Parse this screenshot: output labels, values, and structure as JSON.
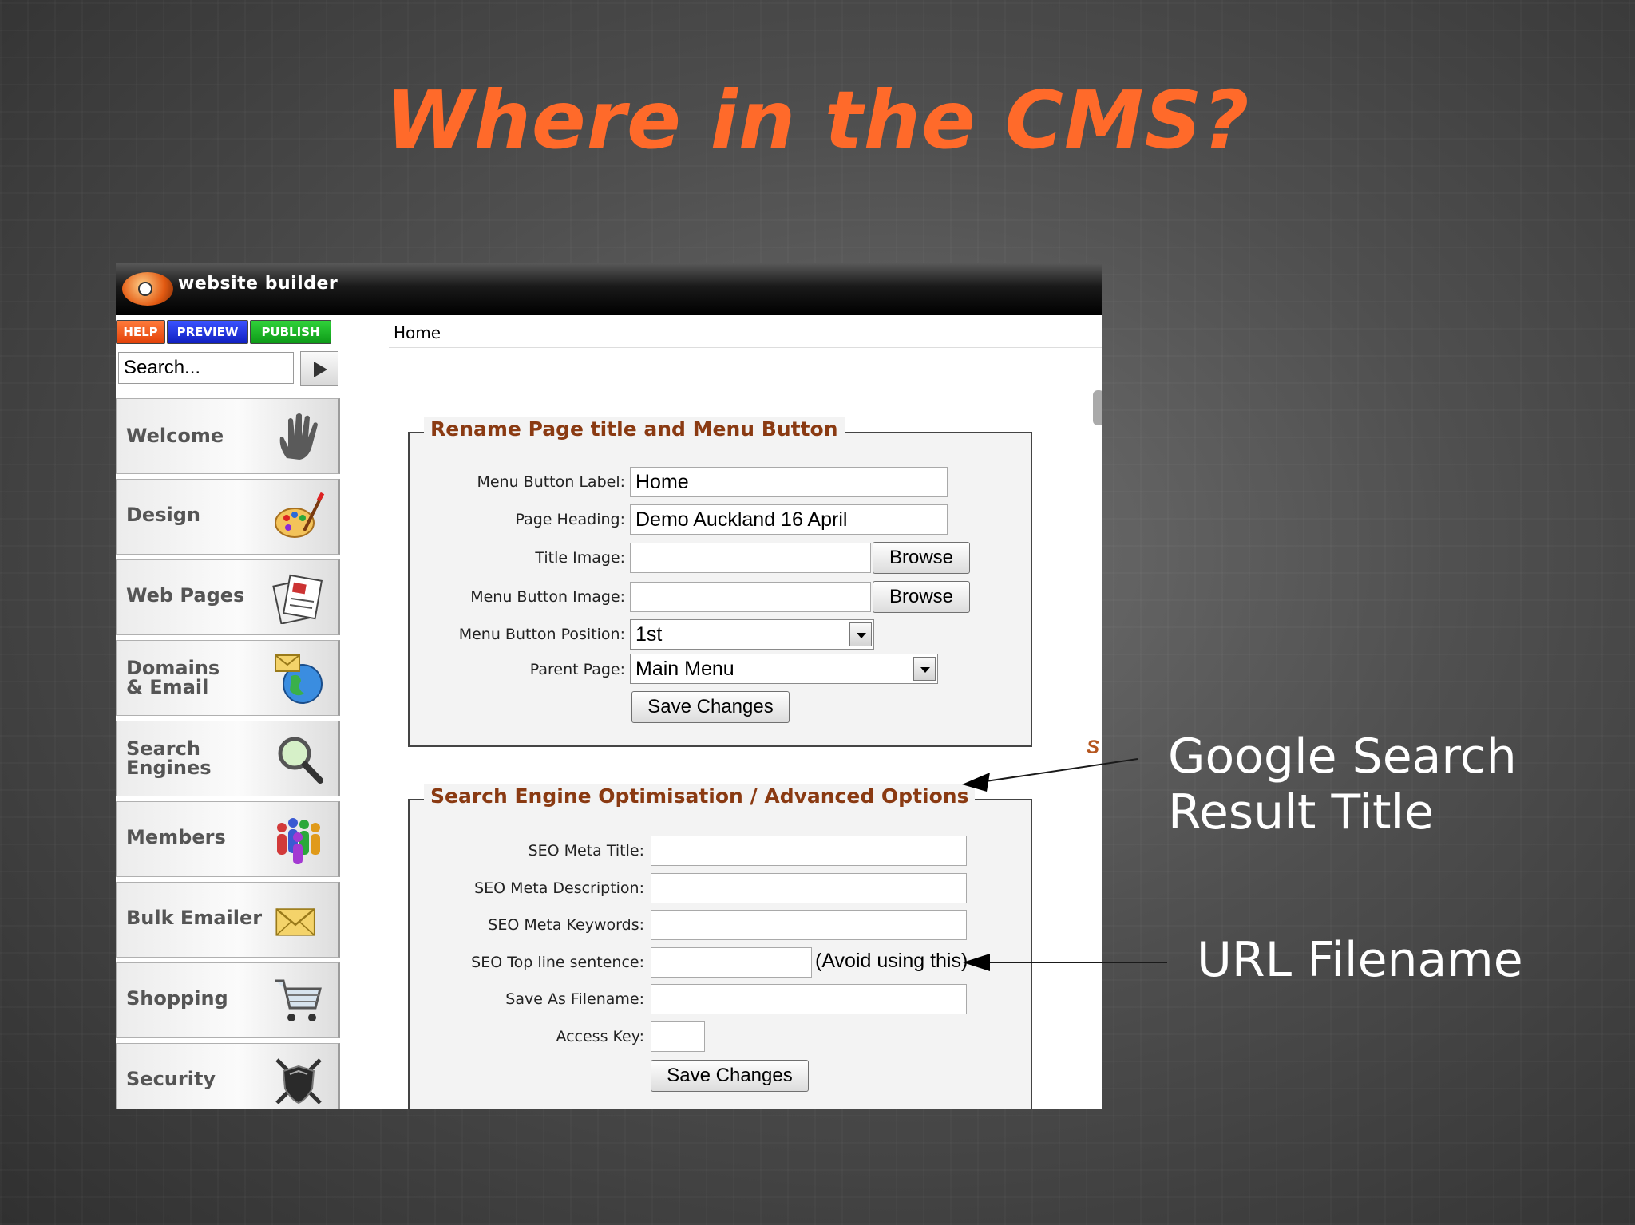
{
  "slide": {
    "title": "Where in the CMS?",
    "annotation_title": "Google Search\nResult Title",
    "annotation_url": "URL Filename"
  },
  "app": {
    "brand": "website builder",
    "top_buttons": {
      "help": "HELP",
      "preview": "PREVIEW",
      "publish": "PUBLISH"
    },
    "search": {
      "value": "Search..."
    },
    "breadcrumb": "Home",
    "cut_off_text": "S"
  },
  "sidebar": {
    "items": [
      {
        "label": "Welcome",
        "icon": "hand-icon"
      },
      {
        "label": "Design",
        "icon": "palette-icon"
      },
      {
        "label": "Web Pages",
        "icon": "document-icon"
      },
      {
        "label": "Domains\n& Email",
        "icon": "globe-mail-icon"
      },
      {
        "label": "Search\nEngines",
        "icon": "magnifier-icon"
      },
      {
        "label": "Members",
        "icon": "people-icon"
      },
      {
        "label": "Bulk Emailer",
        "icon": "envelope-icon"
      },
      {
        "label": "Shopping",
        "icon": "cart-icon"
      },
      {
        "label": "Security",
        "icon": "shield-icon"
      }
    ]
  },
  "rename_form": {
    "legend": "Rename Page title and Menu Button",
    "menu_button_label": {
      "label": "Menu Button Label:",
      "value": "Home"
    },
    "page_heading": {
      "label": "Page Heading:",
      "value": "Demo Auckland 16 April"
    },
    "title_image": {
      "label": "Title Image:",
      "value": "",
      "browse": "Browse"
    },
    "menu_button_image": {
      "label": "Menu Button Image:",
      "value": "",
      "browse": "Browse"
    },
    "menu_button_position": {
      "label": "Menu Button Position:",
      "value": "1st"
    },
    "parent_page": {
      "label": "Parent Page:",
      "value": "Main Menu"
    },
    "save": "Save Changes"
  },
  "seo_form": {
    "legend": "Search Engine Optimisation / Advanced Options",
    "meta_title": {
      "label": "SEO Meta Title:",
      "value": ""
    },
    "meta_description": {
      "label": "SEO Meta Description:",
      "value": ""
    },
    "meta_keywords": {
      "label": "SEO Meta Keywords:",
      "value": ""
    },
    "top_line": {
      "label": "SEO Top line sentence:",
      "value": "",
      "hint": "(Avoid using this)"
    },
    "filename": {
      "label": "Save As Filename:",
      "value": ""
    },
    "access_key": {
      "label": "Access Key:",
      "value": ""
    },
    "save": "Save Changes"
  }
}
